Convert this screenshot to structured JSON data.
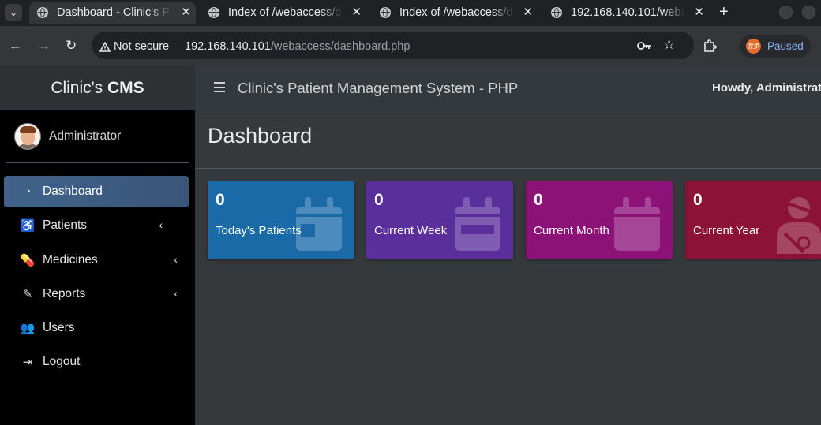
{
  "browser": {
    "tabs": [
      {
        "title": "Dashboard - Clinic's P",
        "active": true
      },
      {
        "title": "Index of /webaccess/d",
        "active": false
      },
      {
        "title": "Index of /webaccess/d",
        "active": false
      },
      {
        "title": "192.168.140.101/weba",
        "active": false
      }
    ],
    "close_glyph": "✕",
    "new_tab_glyph": "+",
    "security_label": "Not secure",
    "url_host": "192.168.140.101",
    "url_path": "/webaccess/dashboard.php",
    "profile_badge": "Paused",
    "profile_avatar_text": "渡步"
  },
  "app": {
    "brand_light": "Clinic's",
    "brand_bold": "CMS",
    "user_name": "Administrator",
    "system_title": "Clinic's Patient Management System - PHP",
    "howdy": "Howdy, Administrat",
    "page_title": "Dashboard"
  },
  "sidebar": {
    "items": [
      {
        "label": "Dashboard",
        "icon": "tachometer-icon",
        "glyph": "◔",
        "active": true,
        "submenu": false
      },
      {
        "label": "Patients",
        "icon": "patient-icon",
        "glyph": "♿",
        "active": false,
        "submenu": true
      },
      {
        "label": "Medicines",
        "icon": "pills-icon",
        "glyph": "💊",
        "active": false,
        "submenu": true
      },
      {
        "label": "Reports",
        "icon": "edit-icon",
        "glyph": "✎",
        "active": false,
        "submenu": true
      },
      {
        "label": "Users",
        "icon": "users-icon",
        "glyph": "👥",
        "active": false,
        "submenu": false
      },
      {
        "label": "Logout",
        "icon": "sign-out-icon",
        "glyph": "⇥",
        "active": false,
        "submenu": false
      }
    ],
    "chevron_glyph": "‹"
  },
  "stats": [
    {
      "value": "0",
      "label": "Today's Patients",
      "color": "#1a6aa8",
      "icon": "calendar-day-icon"
    },
    {
      "value": "0",
      "label": "Current Week",
      "color": "#5a2f9c",
      "icon": "calendar-week-icon"
    },
    {
      "value": "0",
      "label": "Current Month",
      "color": "#8d1278",
      "icon": "calendar-icon"
    },
    {
      "value": "0",
      "label": "Current Year",
      "color": "#8c1238",
      "icon": "user-injured-icon"
    }
  ]
}
